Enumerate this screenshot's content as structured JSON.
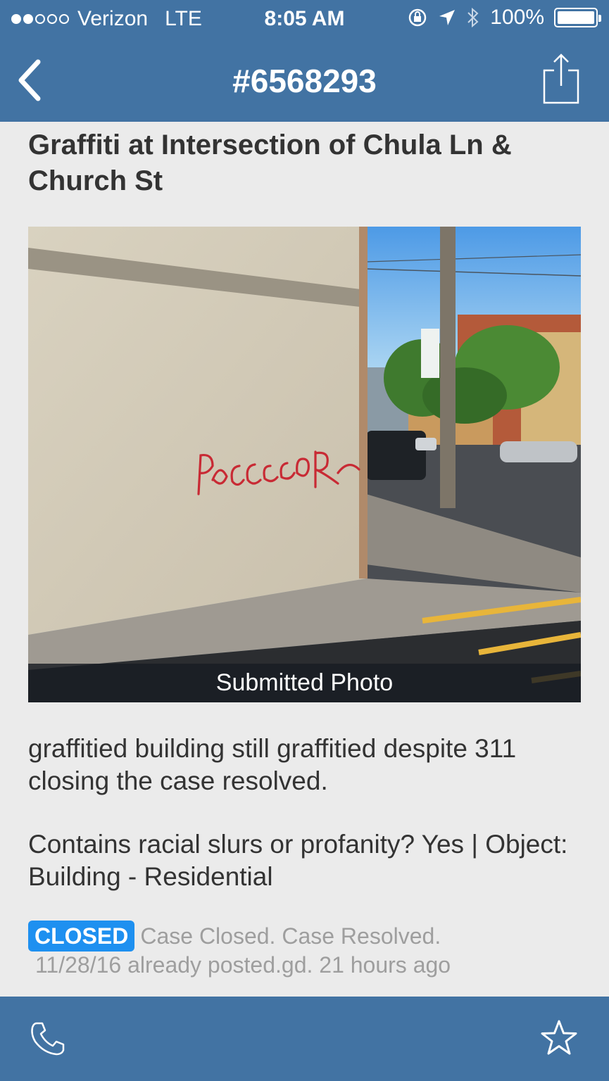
{
  "status_bar": {
    "carrier": "Verizon",
    "network": "LTE",
    "time": "8:05 AM",
    "battery": "100%",
    "signal_bars_filled": 2,
    "signal_bars_total": 5
  },
  "nav": {
    "title": "#6568293",
    "back_icon": "chevron-left-icon",
    "share_icon": "share-icon"
  },
  "report": {
    "title": "Graffiti at Intersection of Chula Ln & Church St",
    "photo_caption": "Submitted Photo",
    "description": "graffitied building still graffitied despite 311 closing the case resolved.",
    "attributes": "Contains racial slurs or profanity? Yes | Object: Building - Residential",
    "status_badge": "CLOSED",
    "status_text": "Case Closed. Case Resolved.",
    "status_date": "11/28/16 already posted.gd. 21 hours ago"
  },
  "bottom_bar": {
    "phone_icon": "phone-icon",
    "star_icon": "star-icon"
  },
  "colors": {
    "bar_blue": "#4273a3",
    "badge_blue": "#1e90f0",
    "background": "#ebebeb"
  }
}
